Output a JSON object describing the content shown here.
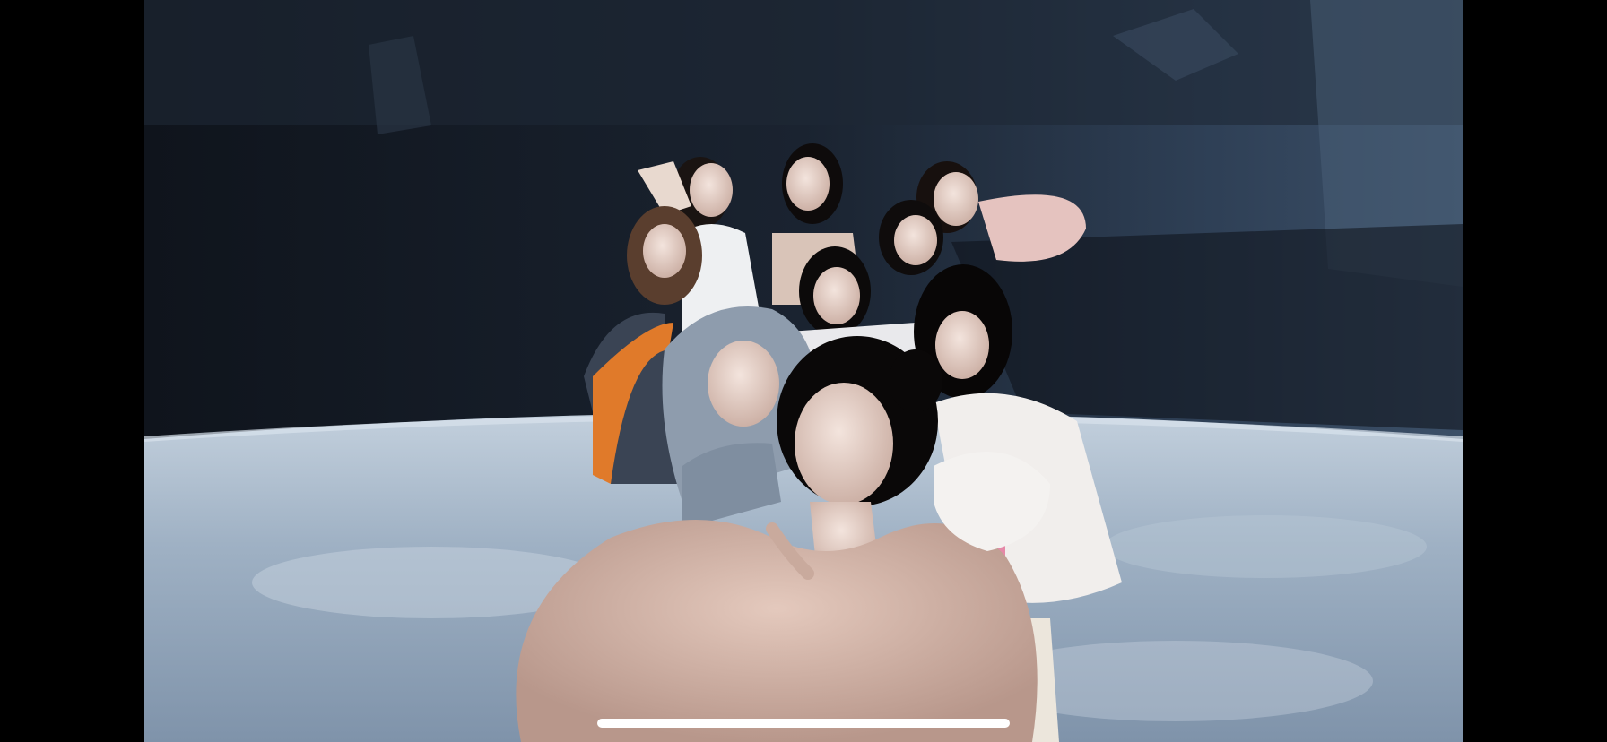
{
  "screen": {
    "background_color": "#000000",
    "orientation": "landscape"
  },
  "video": {
    "state": "playing-fullscreen",
    "controls_visible": false,
    "scene": {
      "backdrop_color": "#1b2533",
      "floor_color": "#a9b8c8",
      "figure_count": 9
    }
  },
  "system": {
    "home_indicator_color": "#ffffff"
  }
}
